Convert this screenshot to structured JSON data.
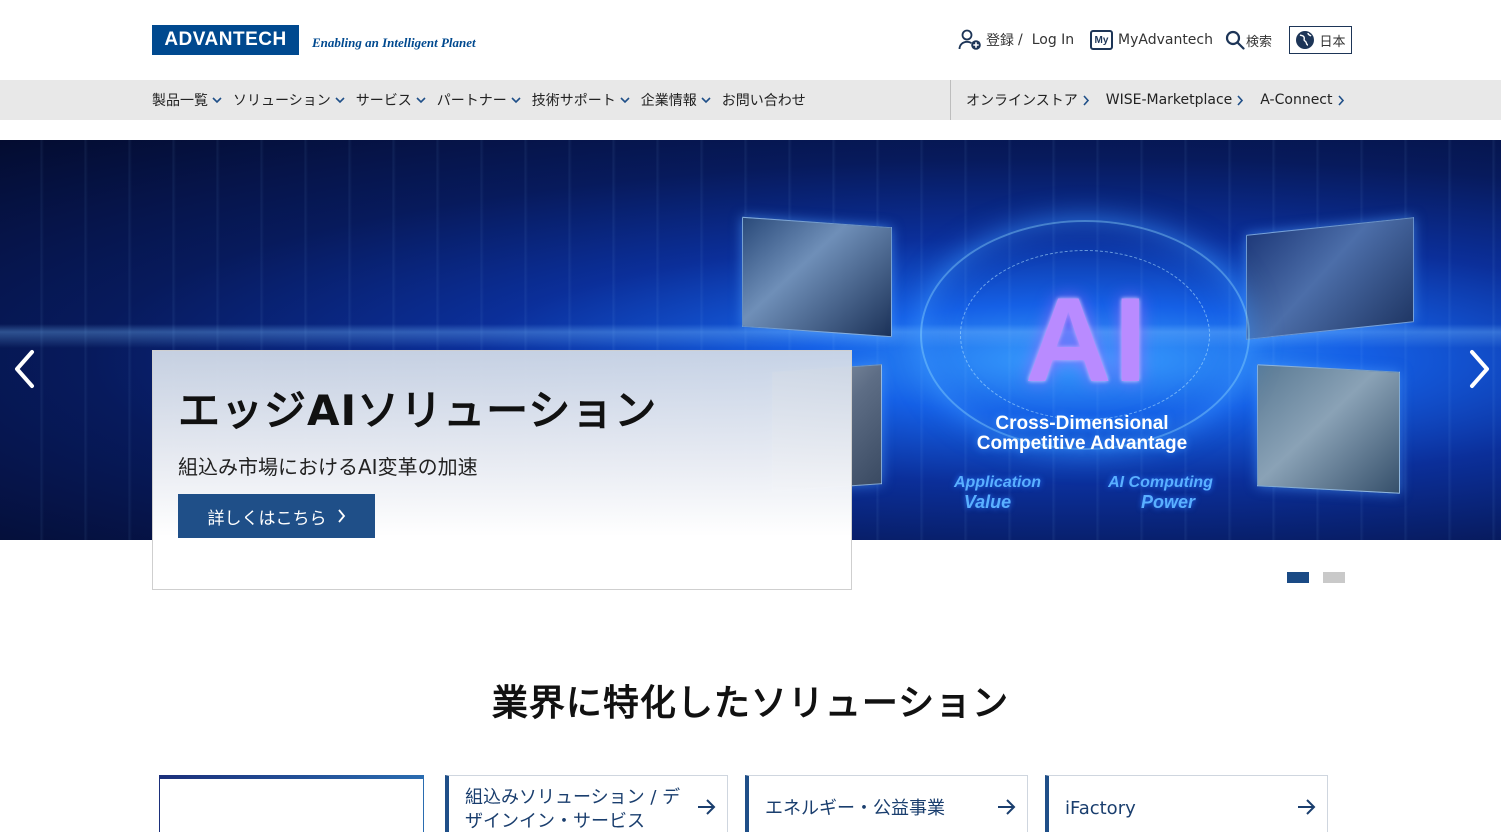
{
  "header": {
    "logo_text": "ADVANTECH",
    "tagline": "Enabling an Intelligent Planet",
    "register_label": "登録",
    "separator": "/",
    "login_label": "Log In",
    "my_badge": "My",
    "my_label": "MyAdvantech",
    "search_label": "検索",
    "language_label": "日本",
    "icons": {
      "register": "user-add-icon",
      "search": "search-icon",
      "language": "globe-icon"
    }
  },
  "nav": {
    "items": [
      {
        "label": "製品一覧"
      },
      {
        "label": "ソリューション"
      },
      {
        "label": "サービス"
      },
      {
        "label": "パートナー"
      },
      {
        "label": "技術サポート"
      },
      {
        "label": "企業情報"
      },
      {
        "label": "お問い合わせ"
      }
    ],
    "right_items": [
      {
        "label": "オンラインストア"
      },
      {
        "label": "WISE-Marketplace"
      },
      {
        "label": "A-Connect"
      }
    ]
  },
  "hero": {
    "image_text": {
      "ai": "AI",
      "line1": "Cross-Dimensional",
      "line2": "Competitive Advantage",
      "app1": "Application",
      "app2": "Value",
      "pow1": "AI Computing",
      "pow2": "Power"
    },
    "caption": {
      "title": "エッジAIソリューション",
      "subtitle": "組込み市場におけるAI変革の加速",
      "button_label": "詳しくはこちら"
    },
    "slides": {
      "count": 2,
      "active": 1
    }
  },
  "industry": {
    "title": "業界に特化したソリューション",
    "cards": [
      {
        "label": ""
      },
      {
        "label": "組込みソリューション / デザインイン・サービス"
      },
      {
        "label": "エネルギー・公益事業"
      },
      {
        "label": "iFactory"
      }
    ]
  },
  "colors": {
    "brand_blue": "#00498f",
    "button_blue": "#1f4f88",
    "nav_bg": "#e8e8e8",
    "dot_active": "#1a4a85",
    "dot_inactive": "#c9c9c9"
  }
}
